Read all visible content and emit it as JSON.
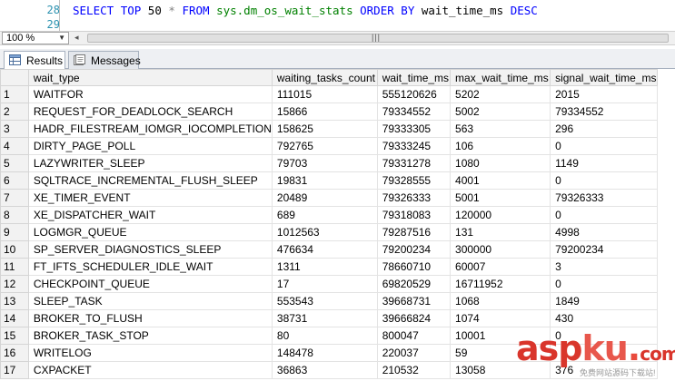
{
  "editor": {
    "line_numbers": [
      "28",
      "29"
    ],
    "sql_tokens": [
      {
        "text": "SELECT",
        "cls": "kw"
      },
      {
        "text": " ",
        "cls": ""
      },
      {
        "text": "TOP",
        "cls": "kw"
      },
      {
        "text": " 50 ",
        "cls": ""
      },
      {
        "text": "*",
        "cls": "gr"
      },
      {
        "text": " ",
        "cls": ""
      },
      {
        "text": "FROM",
        "cls": "kw"
      },
      {
        "text": " ",
        "cls": ""
      },
      {
        "text": "sys.dm_os_wait_stats",
        "cls": "sys"
      },
      {
        "text": " ",
        "cls": ""
      },
      {
        "text": "ORDER",
        "cls": "kw"
      },
      {
        "text": " ",
        "cls": ""
      },
      {
        "text": "BY",
        "cls": "kw"
      },
      {
        "text": " wait_time_ms ",
        "cls": ""
      },
      {
        "text": "DESC",
        "cls": "kw"
      }
    ]
  },
  "zoom": {
    "value": "100 %"
  },
  "tabs": {
    "results": "Results",
    "messages": "Messages"
  },
  "grid": {
    "columns": [
      "wait_type",
      "waiting_tasks_count",
      "wait_time_ms",
      "max_wait_time_ms",
      "signal_wait_time_ms"
    ],
    "rows": [
      [
        "1",
        "WAITFOR",
        "111015",
        "555120626",
        "5202",
        "2015"
      ],
      [
        "2",
        "REQUEST_FOR_DEADLOCK_SEARCH",
        "15866",
        "79334552",
        "5002",
        "79334552"
      ],
      [
        "3",
        "HADR_FILESTREAM_IOMGR_IOCOMPLETION",
        "158625",
        "79333305",
        "563",
        "296"
      ],
      [
        "4",
        "DIRTY_PAGE_POLL",
        "792765",
        "79333245",
        "106",
        "0"
      ],
      [
        "5",
        "LAZYWRITER_SLEEP",
        "79703",
        "79331278",
        "1080",
        "1149"
      ],
      [
        "6",
        "SQLTRACE_INCREMENTAL_FLUSH_SLEEP",
        "19831",
        "79328555",
        "4001",
        "0"
      ],
      [
        "7",
        "XE_TIMER_EVENT",
        "20489",
        "79326333",
        "5001",
        "79326333"
      ],
      [
        "8",
        "XE_DISPATCHER_WAIT",
        "689",
        "79318083",
        "120000",
        "0"
      ],
      [
        "9",
        "LOGMGR_QUEUE",
        "1012563",
        "79287516",
        "131",
        "4998"
      ],
      [
        "10",
        "SP_SERVER_DIAGNOSTICS_SLEEP",
        "476634",
        "79200234",
        "300000",
        "79200234"
      ],
      [
        "11",
        "FT_IFTS_SCHEDULER_IDLE_WAIT",
        "1311",
        "78660710",
        "60007",
        "3"
      ],
      [
        "12",
        "CHECKPOINT_QUEUE",
        "17",
        "69820529",
        "16711952",
        "0"
      ],
      [
        "13",
        "SLEEP_TASK",
        "553543",
        "39668731",
        "1068",
        "1849"
      ],
      [
        "14",
        "BROKER_TO_FLUSH",
        "38731",
        "39666824",
        "1074",
        "430"
      ],
      [
        "15",
        "BROKER_TASK_STOP",
        "80",
        "800047",
        "10001",
        "0"
      ],
      [
        "16",
        "WRITELOG",
        "148478",
        "220037",
        "59",
        ""
      ],
      [
        "17",
        "CXPACKET",
        "36863",
        "210532",
        "13058",
        "376"
      ]
    ]
  },
  "watermark": {
    "asp": "asp",
    "ku": "ku",
    "dot": ".",
    "com": "com",
    "subtitle": "免费网站源码下载站!"
  }
}
